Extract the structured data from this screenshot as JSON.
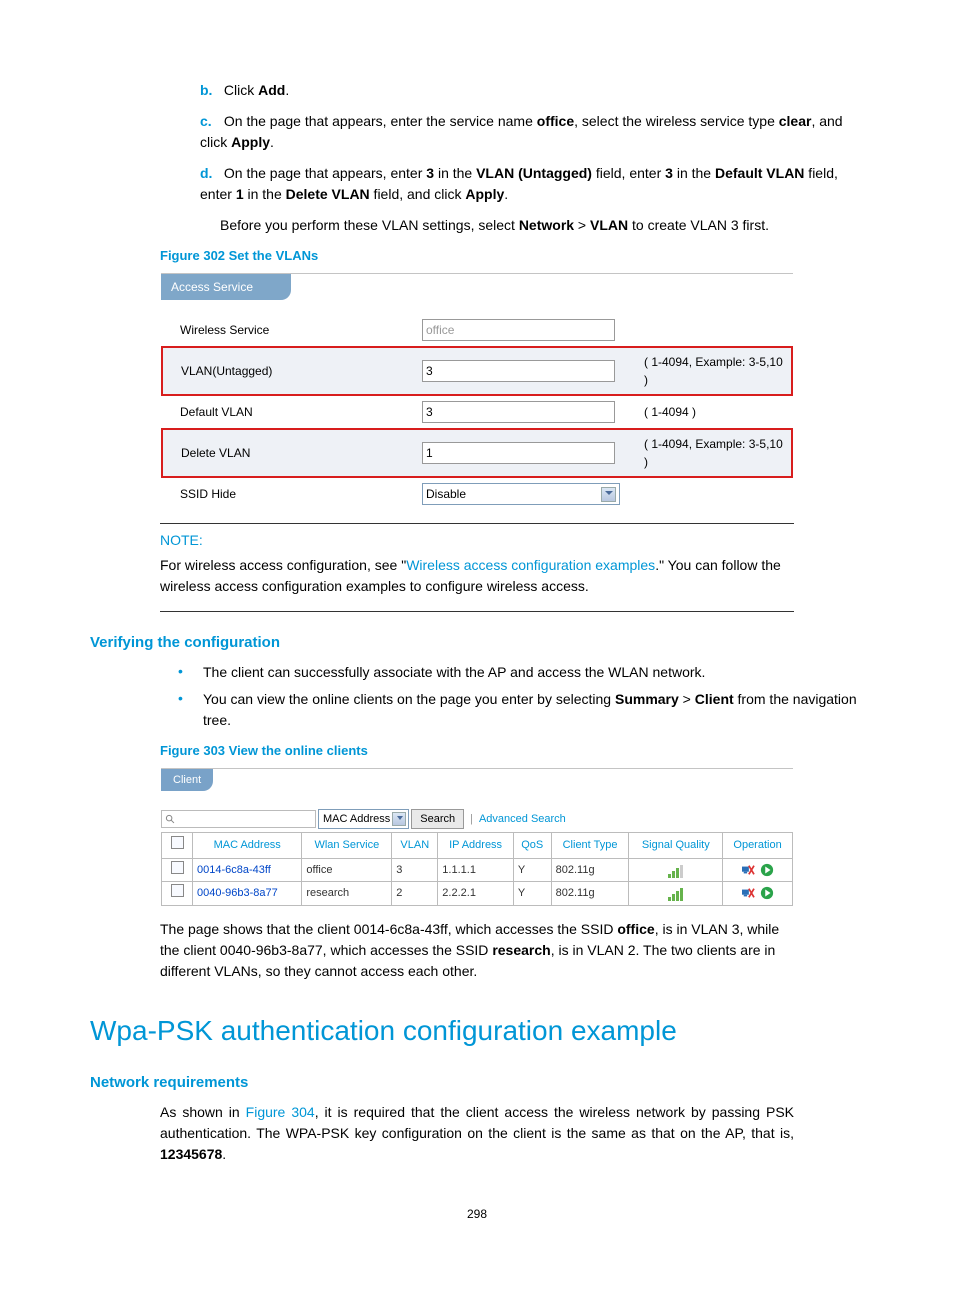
{
  "steps": {
    "b": {
      "marker": "b.",
      "pre": "Click ",
      "bold": "Add",
      "post": "."
    },
    "c": {
      "marker": "c.",
      "t1": "On the page that appears, enter the service name ",
      "b1": "office",
      "t2": ", select the wireless service type ",
      "b2": "clear",
      "t3": ", and click ",
      "b3": "Apply",
      "t4": "."
    },
    "d": {
      "marker": "d.",
      "t1": "On the page that appears, enter ",
      "b1": "3",
      "t2": " in the ",
      "b2": "VLAN (Untagged)",
      "t3": " field, enter ",
      "b3": "3",
      "t4": " in the ",
      "b4": "Default VLAN",
      "t5": " field, enter ",
      "b5": "1",
      "t6": " in the ",
      "b6": "Delete VLAN",
      "t7": " field, and click ",
      "b7": "Apply",
      "t8": "."
    },
    "d_note": {
      "t1": "Before you perform these VLAN settings, select ",
      "b1": "Network",
      "t2": " > ",
      "b2": "VLAN",
      "t3": " to create VLAN 3 first."
    }
  },
  "fig302": {
    "caption": "Figure 302 Set the VLANs",
    "tab": "Access Service",
    "rows": {
      "wireless": {
        "label": "Wireless Service",
        "value": "office"
      },
      "vlan_u": {
        "label": "VLAN(Untagged)",
        "value": "3",
        "hint": "( 1-4094, Example: 3-5,10 )"
      },
      "default": {
        "label": "Default VLAN",
        "value": "3",
        "hint": "( 1-4094 )"
      },
      "delete": {
        "label": "Delete VLAN",
        "value": "1",
        "hint": "( 1-4094, Example: 3-5,10 )"
      },
      "ssid": {
        "label": "SSID Hide",
        "value": "Disable"
      }
    }
  },
  "note": {
    "head": "NOTE:",
    "t1": "For wireless access configuration, see \"",
    "link": "Wireless access configuration examples",
    "t2": ".\" You can follow the wireless access configuration examples to configure wireless access."
  },
  "verify": {
    "title": "Verifying the configuration",
    "b1": "The client can successfully associate with the AP and access the WLAN network.",
    "b2_t1": "You can view the online clients on the page you enter by selecting ",
    "b2_b1": "Summary",
    "b2_t2": " > ",
    "b2_b2": "Client",
    "b2_t3": " from the navigation tree."
  },
  "fig303": {
    "caption": "Figure 303 View the online clients",
    "tab": "Client",
    "dd": "MAC Address",
    "search_btn": "Search",
    "adv": "Advanced Search",
    "headers": [
      "MAC Address",
      "Wlan Service",
      "VLAN",
      "IP Address",
      "QoS",
      "Client Type",
      "Signal Quality",
      "Operation"
    ],
    "rows": [
      {
        "mac": "0014-6c8a-43ff",
        "svc": "office",
        "vlan": "3",
        "ip": "1.1.1.1",
        "qos": "Y",
        "ctype": "802.11g",
        "sig": "s3"
      },
      {
        "mac": "0040-96b3-8a77",
        "svc": "research",
        "vlan": "2",
        "ip": "2.2.2.1",
        "qos": "Y",
        "ctype": "802.11g",
        "sig": "s4"
      }
    ]
  },
  "result_para": {
    "t1": "The page shows that the client 0014-6c8a-43ff, which accesses the SSID ",
    "b1": "office",
    "t2": ", is in VLAN 3, while the client 0040-96b3-8a77, which accesses the SSID ",
    "b2": "research",
    "t3": ", is in VLAN 2. The two clients are in different VLANs, so they cannot access each other."
  },
  "wpa": {
    "title": "Wpa-PSK authentication configuration example",
    "req_title": "Network requirements",
    "req_t1": "As shown in ",
    "req_link": "Figure 304",
    "req_t2": ", it is required that the client access the wireless network by passing PSK authentication. The WPA-PSK key configuration on the client is the same as that on the AP, that is, ",
    "req_b1": "12345678",
    "req_t3": "."
  },
  "page": "298"
}
